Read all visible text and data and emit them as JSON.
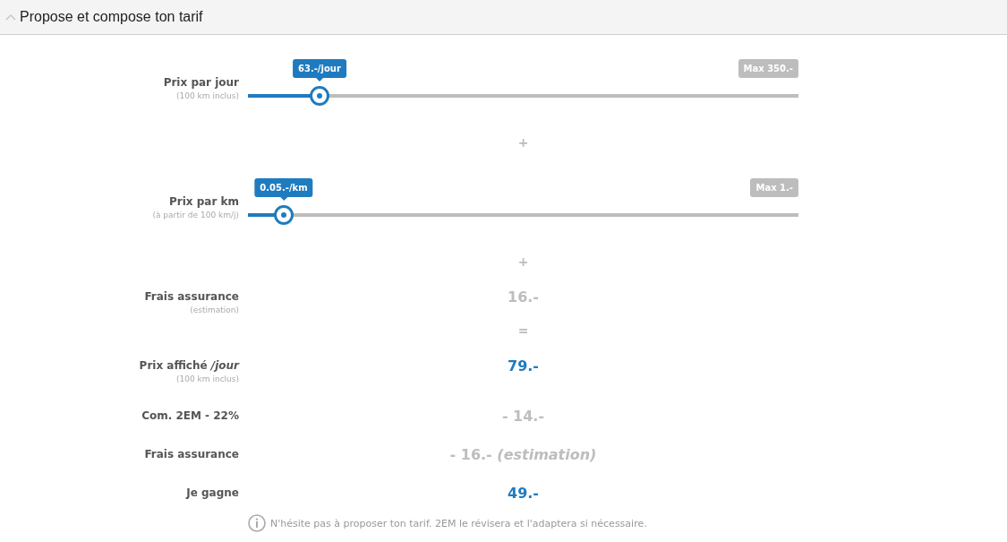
{
  "header": {
    "title": "Propose et compose ton tarif",
    "expanded": true
  },
  "rows": [
    {
      "kind": "slider",
      "label": "Prix par jour",
      "sublabel": "(100 km inclus)",
      "bubble": "63.-/jour",
      "max": "Max 350.-",
      "level": 0.13
    },
    {
      "kind": "operator",
      "symbol": "+"
    },
    {
      "kind": "slider",
      "label": "Prix par km",
      "sublabel": "(à partir de 100 km/j)",
      "bubble": "0.05.-/km",
      "max": "Max 1.-",
      "level": 0.065
    },
    {
      "kind": "operator",
      "symbol": "+"
    },
    {
      "kind": "value",
      "label": "Frais assurance",
      "sublabel": "(estimation)",
      "value": "16.-",
      "color": "#bdbdbd"
    },
    {
      "kind": "operator",
      "symbol": "="
    },
    {
      "kind": "value",
      "label": "Prix affiché */jour*",
      "sublabel": "(100 km inclus)",
      "value": "79.-",
      "color": "#1f7bbf"
    },
    {
      "kind": "value",
      "label": "Com. 2EM - 22%",
      "value": "- 14.-",
      "color": "#bdbdbd"
    },
    {
      "kind": "value",
      "label": "Frais assurance",
      "value": "- 16.- *(estimation)*",
      "color": "#bdbdbd"
    },
    {
      "kind": "value",
      "label": "Je gagne",
      "value": "49.-",
      "color": "#1f7bbf"
    }
  ],
  "note": "N'hésite pas à proposer ton tarif. 2EM le révisera et l'adaptera si nécessaire."
}
